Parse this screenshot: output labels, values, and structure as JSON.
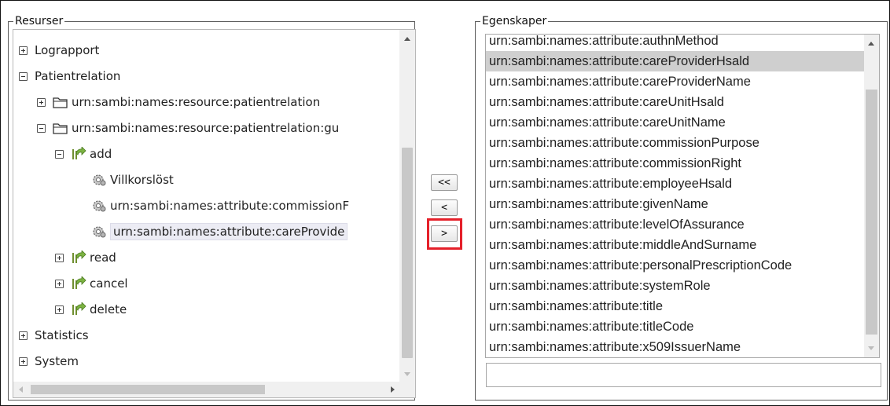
{
  "resurser": {
    "legend": "Resurser",
    "tree": [
      {
        "label": "Lograpport",
        "expander": "plus",
        "icon": null
      },
      {
        "label": "Patientrelation",
        "expander": "minus",
        "icon": null
      },
      {
        "label": "urn:sambi:names:resource:patientrelation",
        "expander": "plus",
        "icon": "folder-icon"
      },
      {
        "label": "urn:sambi:names:resource:patientrelation:gu",
        "expander": "minus",
        "icon": "folder-icon"
      },
      {
        "label": "add",
        "expander": "minus",
        "icon": "action-arrow-icon"
      },
      {
        "label": "Villkorslöst",
        "expander": null,
        "icon": "gear-condition-icon"
      },
      {
        "label": "urn:sambi:names:attribute:commissionF",
        "expander": null,
        "icon": "gear-condition-icon"
      },
      {
        "label": "urn:sambi:names:attribute:careProvide",
        "expander": null,
        "icon": "gear-condition-icon",
        "selected": true
      },
      {
        "label": "read",
        "expander": "plus",
        "icon": "action-arrow-icon"
      },
      {
        "label": "cancel",
        "expander": "plus",
        "icon": "action-arrow-icon"
      },
      {
        "label": "delete",
        "expander": "plus",
        "icon": "action-arrow-icon"
      },
      {
        "label": "Statistics",
        "expander": "plus",
        "icon": null
      },
      {
        "label": "System",
        "expander": "plus",
        "icon": null
      }
    ]
  },
  "buttons": {
    "move_all_left": "<<",
    "move_left": "<",
    "move_right": ">"
  },
  "egenskaper": {
    "legend": "Egenskaper",
    "items": [
      "urn:sambi:names:attribute:authnMethod",
      "urn:sambi:names:attribute:careProviderHsald",
      "urn:sambi:names:attribute:careProviderName",
      "urn:sambi:names:attribute:careUnitHsald",
      "urn:sambi:names:attribute:careUnitName",
      "urn:sambi:names:attribute:commissionPurpose",
      "urn:sambi:names:attribute:commissionRight",
      "urn:sambi:names:attribute:employeeHsald",
      "urn:sambi:names:attribute:givenName",
      "urn:sambi:names:attribute:levelOfAssurance",
      "urn:sambi:names:attribute:middleAndSurname",
      "urn:sambi:names:attribute:personalPrescriptionCode",
      "urn:sambi:names:attribute:systemRole",
      "urn:sambi:names:attribute:title",
      "urn:sambi:names:attribute:titleCode",
      "urn:sambi:names:attribute:x509IssuerName"
    ],
    "selected_index": 1,
    "input_value": ""
  },
  "colors": {
    "highlight_border": "#e5202a",
    "list_selected": "#cfcfcf",
    "tree_selected": "#ececf4"
  }
}
